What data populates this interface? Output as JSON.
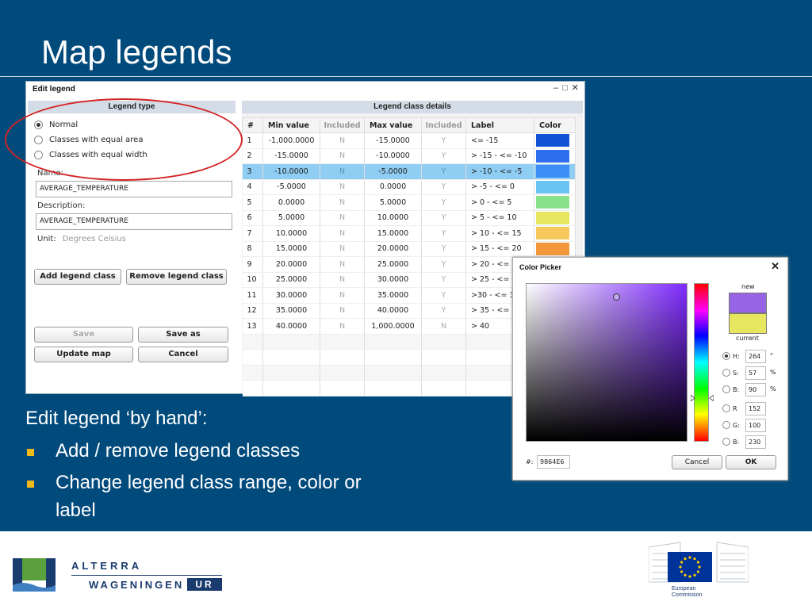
{
  "slide": {
    "title": "Map legends",
    "body_heading": "Edit legend ‘by hand’:",
    "bullets": [
      "Add / remove legend classes",
      "Change legend class range, color or",
      "label"
    ]
  },
  "edit_legend": {
    "title": "Edit legend",
    "window_controls": "– □ ✕",
    "legend_type_header": "Legend type",
    "legend_types": [
      {
        "label": "Normal",
        "selected": true
      },
      {
        "label": "Classes with equal area",
        "selected": false
      },
      {
        "label": "Classes with equal width",
        "selected": false
      }
    ],
    "name_label": "Name:",
    "name_value": "AVERAGE_TEMPERATURE",
    "description_label": "Description:",
    "description_value": "AVERAGE_TEMPERATURE",
    "unit_label": "Unit:",
    "unit_value": "Degrees Celsius",
    "buttons": {
      "add_class": "Add legend class",
      "remove_class": "Remove legend class",
      "save": "Save",
      "save_as": "Save as",
      "update_map": "Update map",
      "cancel": "Cancel"
    },
    "class_details_header": "Legend class details",
    "columns": [
      "#",
      "Min value",
      "Included",
      "Max value",
      "Included",
      "Label",
      "Color"
    ],
    "rows": [
      {
        "n": "1",
        "min": "-1,000.0000",
        "inc_min": "N",
        "max": "-15.0000",
        "inc_max": "Y",
        "label": "<= -15",
        "color": "#1152d4"
      },
      {
        "n": "2",
        "min": "-15.0000",
        "inc_min": "N",
        "max": "-10.0000",
        "inc_max": "Y",
        "label": "> -15 - <= -10",
        "color": "#2e6fef"
      },
      {
        "n": "3",
        "min": "-10.0000",
        "inc_min": "N",
        "max": "-5.0000",
        "inc_max": "Y",
        "label": "> -10 - <= -5",
        "color": "#3c8ef5"
      },
      {
        "n": "4",
        "min": "-5.0000",
        "inc_min": "N",
        "max": "0.0000",
        "inc_max": "Y",
        "label": "> -5 - <= 0",
        "color": "#69c3f4"
      },
      {
        "n": "5",
        "min": "0.0000",
        "inc_min": "N",
        "max": "5.0000",
        "inc_max": "Y",
        "label": "> 0 - <= 5",
        "color": "#8ae38a"
      },
      {
        "n": "6",
        "min": "5.0000",
        "inc_min": "N",
        "max": "10.0000",
        "inc_max": "Y",
        "label": "> 5 - <= 10",
        "color": "#e6e65f"
      },
      {
        "n": "7",
        "min": "10.0000",
        "inc_min": "N",
        "max": "15.0000",
        "inc_max": "Y",
        "label": "> 10 - <= 15",
        "color": "#f7c85a"
      },
      {
        "n": "8",
        "min": "15.0000",
        "inc_min": "N",
        "max": "20.0000",
        "inc_max": "Y",
        "label": "> 15 - <= 20",
        "color": "#f4963a"
      },
      {
        "n": "9",
        "min": "20.0000",
        "inc_min": "N",
        "max": "25.0000",
        "inc_max": "Y",
        "label": "> 20 - <=",
        "color": "#ee6a2a"
      },
      {
        "n": "10",
        "min": "25.0000",
        "inc_min": "N",
        "max": "30.0000",
        "inc_max": "Y",
        "label": "> 25 - <=",
        "color": "#e5461f"
      },
      {
        "n": "11",
        "min": "30.0000",
        "inc_min": "N",
        "max": "35.0000",
        "inc_max": "Y",
        "label": ">30 - <= 3",
        "color": "#d62a19"
      },
      {
        "n": "12",
        "min": "35.0000",
        "inc_min": "N",
        "max": "40.0000",
        "inc_max": "Y",
        "label": "> 35 - <= 4",
        "color": "#c01414"
      },
      {
        "n": "13",
        "min": "40.0000",
        "inc_min": "N",
        "max": "1,000.0000",
        "inc_max": "N",
        "label": "> 40",
        "color": "#a00f0f"
      }
    ],
    "selected_row": 2
  },
  "color_picker": {
    "title": "Color Picker",
    "close": "✕",
    "new_label": "new",
    "current_label": "current",
    "new_color": "#9864e6",
    "current_color": "#e6e65f",
    "fields": [
      {
        "key": "H:",
        "value": "264",
        "unit": "°",
        "selected": true
      },
      {
        "key": "S:",
        "value": "57",
        "unit": "%",
        "selected": false
      },
      {
        "key": "B:",
        "value": "90",
        "unit": "%",
        "selected": false
      },
      {
        "key": "R",
        "value": "152",
        "unit": "",
        "selected": false
      },
      {
        "key": "G:",
        "value": "100",
        "unit": "",
        "selected": false
      },
      {
        "key": "B:",
        "value": "230",
        "unit": "",
        "selected": false
      }
    ],
    "hex_label": "#:",
    "hex_value": "9864E6",
    "cancel": "Cancel",
    "ok": "OK"
  },
  "footer": {
    "alterra": "ALTERRA",
    "wageningen": "WAGENINGEN",
    "ur": "UR",
    "ec_line1": "European",
    "ec_line2": "Commission",
    "ec_flag_color": "#003399",
    "ec_star_color": "#ffcc00"
  }
}
